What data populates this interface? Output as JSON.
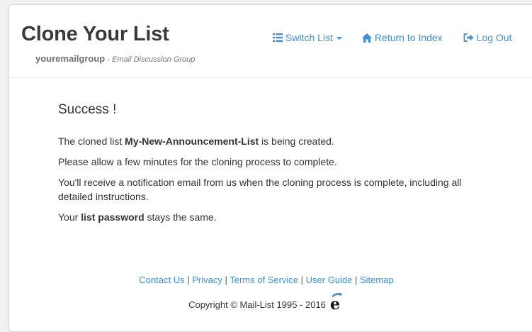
{
  "header": {
    "title": "Clone Your List",
    "group_name": "youremailgroup",
    "group_desc": " - Email Discussion Group"
  },
  "nav": {
    "switch_list": "Switch List",
    "return_index": "Return to Index",
    "log_out": "Log Out"
  },
  "content": {
    "heading": "Success !",
    "p1_pre": "The cloned list ",
    "p1_list": "My-New-Announcement-List",
    "p1_post": " is being created.",
    "p2": "Please allow a few minutes for the cloning process to complete.",
    "p3": "You'll receive a notification email from us when the cloning process is complete, including all detailed instructions.",
    "p4_pre": "Your ",
    "p4_bold": "list password",
    "p4_post": " stays the same."
  },
  "footer": {
    "links": [
      "Contact Us",
      "Privacy",
      "Terms of Service",
      "User Guide",
      "Sitemap"
    ],
    "separator": " | ",
    "copyright": "Copyright © Mail-List 1995 - 2016"
  },
  "colors": {
    "link": "#3f8fd2",
    "text": "#333333",
    "background": "#f1f1f1"
  },
  "icons": {
    "switch_list": "list-icon",
    "return_index": "home-icon",
    "log_out": "logout-icon",
    "logo": "e-logo"
  }
}
